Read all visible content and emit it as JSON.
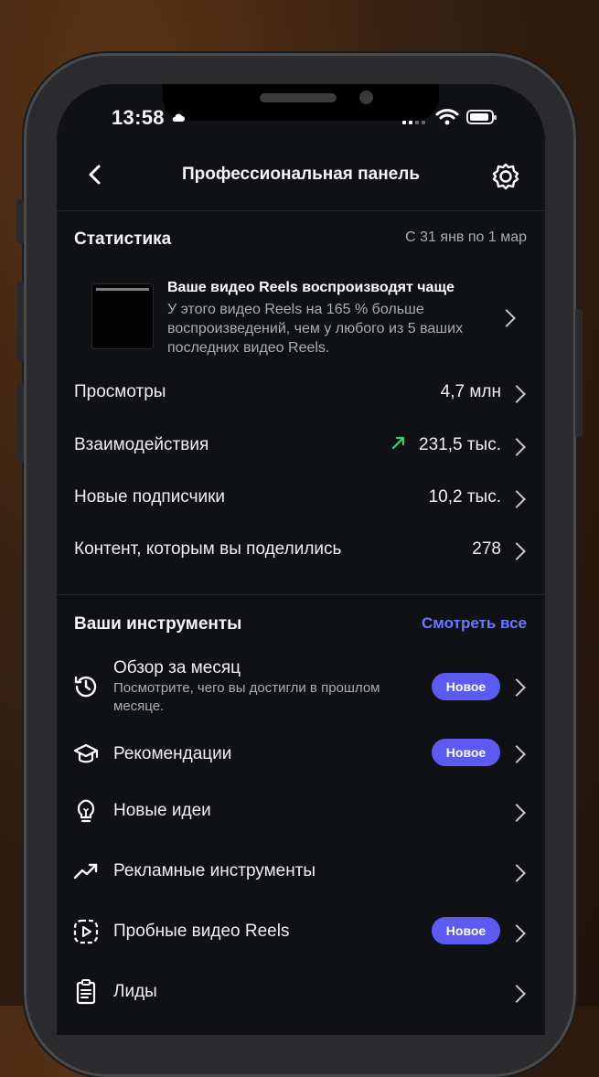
{
  "status_bar": {
    "time": "13:58"
  },
  "nav": {
    "title": "Профессиональная панель"
  },
  "stats": {
    "title": "Статистика",
    "date_range": "С 31 янв по 1 мар",
    "highlight": {
      "title": "Ваше видео Reels воспроизводят чаще",
      "description": "У этого видео Reels на 165 % больше воспроизведений, чем у любого из 5 ваших последних видео Reels."
    },
    "rows": [
      {
        "label": "Просмотры",
        "value": "4,7 млн"
      },
      {
        "label": "Взаимодействия",
        "value": "231,5 тыс.",
        "trend": "up"
      },
      {
        "label": "Новые подписчики",
        "value": "10,2 тыс."
      },
      {
        "label": "Контент, которым вы поделились",
        "value": "278"
      }
    ]
  },
  "tools": {
    "title": "Ваши инструменты",
    "see_all": "Смотреть все",
    "items": [
      {
        "label": "Обзор за месяц",
        "sub": "Посмотрите, чего вы достигли в прошлом месяце.",
        "badge": "Новое",
        "icon": "history-icon"
      },
      {
        "label": "Рекомендации",
        "badge": "Новое",
        "icon": "graduation-cap-icon"
      },
      {
        "label": "Новые идеи",
        "icon": "lightbulb-icon"
      },
      {
        "label": "Рекламные инструменты",
        "icon": "trending-up-icon"
      },
      {
        "label": "Пробные видео Reels",
        "badge": "Новое",
        "icon": "reels-trial-icon"
      },
      {
        "label": "Лиды",
        "icon": "clipboard-icon"
      }
    ]
  },
  "colors": {
    "accent": "#5b5bf2",
    "link": "#6b79ff",
    "trend_up": "#3ccf74",
    "background": "#101114"
  }
}
